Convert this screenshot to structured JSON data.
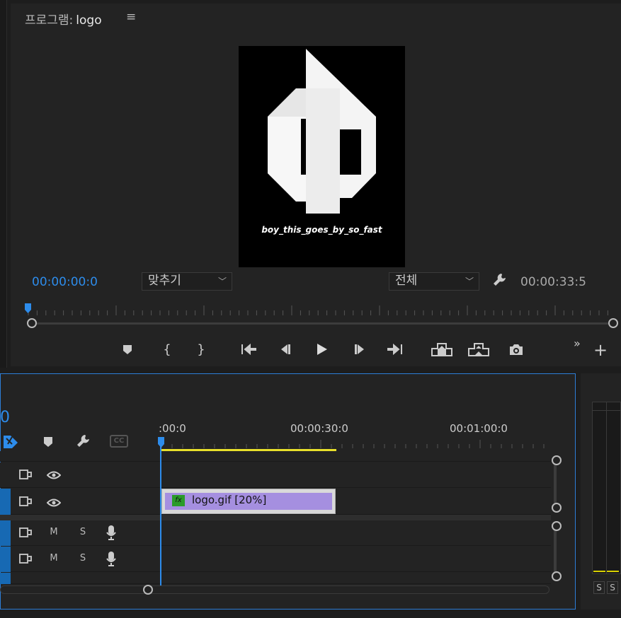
{
  "program_monitor": {
    "title_prefix": "프로그램:",
    "sequence_name": "logo",
    "caption_text": "boy_this_goes_by_so_fast",
    "current_timecode": "00:00:00:0",
    "duration_timecode": "00:00:33:5",
    "fit_dropdown": "맞추기",
    "resolution_dropdown": "전체",
    "transport_buttons": [
      "add-marker",
      "mark-in",
      "mark-out",
      "go-to-in",
      "step-back",
      "play",
      "step-forward",
      "go-to-out",
      "lift",
      "extract",
      "export-frame",
      "more",
      "add"
    ]
  },
  "timeline": {
    "timecode_fragment": "0",
    "ruler_labels": [
      ":00:0",
      "00:00:30:0",
      "00:01:00:0"
    ],
    "tracks": [
      {
        "type": "video",
        "mute_label": "",
        "solo_label": ""
      },
      {
        "type": "video",
        "mute_label": "",
        "solo_label": ""
      },
      {
        "type": "audio",
        "mute_label": "M",
        "solo_label": "S"
      },
      {
        "type": "audio",
        "mute_label": "M",
        "solo_label": "S"
      }
    ],
    "clip": {
      "fx_label": "fx",
      "name": "logo.gif [20%]"
    },
    "cc_label": "CC"
  },
  "audio_meter": {
    "solo_left": "S",
    "solo_right": "S"
  },
  "colors": {
    "accent": "#2d8ceb",
    "workarea": "#e8e02b",
    "clip": "#a58fe0",
    "fx": "#2a9b2a",
    "panel_border": "#2d7ed8"
  }
}
